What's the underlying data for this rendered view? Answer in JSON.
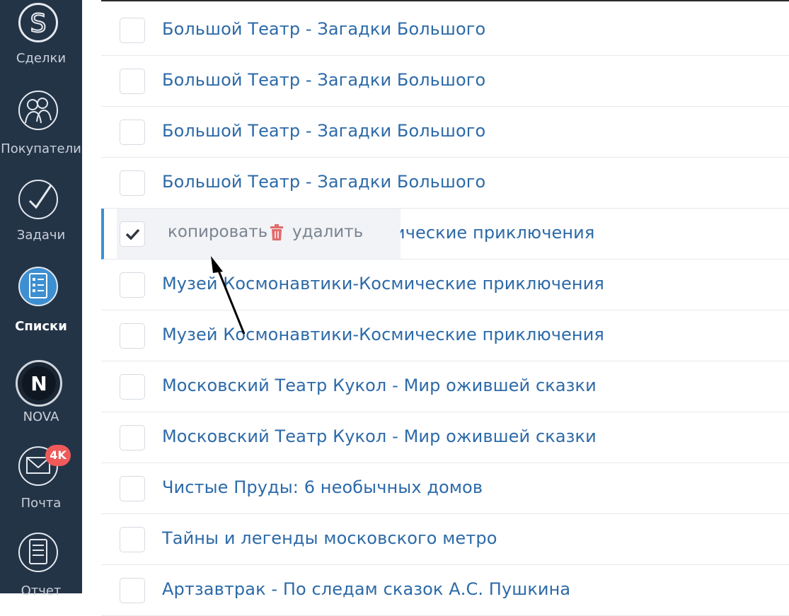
{
  "sidebar": {
    "items": [
      {
        "label": "Сделки",
        "icon": "deals-s-icon"
      },
      {
        "label": "Покупатели",
        "icon": "customers-icon"
      },
      {
        "label": "Задачи",
        "icon": "tasks-check-icon"
      },
      {
        "label": "Списки",
        "icon": "lists-icon",
        "active": true
      },
      {
        "label": "NOVA",
        "icon": "nova-icon"
      },
      {
        "label": "Почта",
        "icon": "mail-icon",
        "badge": "4K"
      },
      {
        "label": "Отчет",
        "icon": "report-icon"
      }
    ]
  },
  "actions": {
    "copy_label": "копировать",
    "delete_label": "удалить"
  },
  "rows": [
    {
      "title": "Большой Театр - Загадки Большого",
      "checked": false
    },
    {
      "title": "Большой Театр - Загадки Большого",
      "checked": false
    },
    {
      "title": "Большой Театр - Загадки Большого",
      "checked": false
    },
    {
      "title": "Большой Театр - Загадки Большого",
      "checked": false
    },
    {
      "title": "ические приключения",
      "checked": true
    },
    {
      "title": "Музей Космонавтики-Космические приключения",
      "checked": false
    },
    {
      "title": "Музей Космонавтики-Космические приключения",
      "checked": false
    },
    {
      "title": "Московский Театр Кукол - Мир ожившей сказки",
      "checked": false
    },
    {
      "title": "Московский Театр Кукол - Мир ожившей сказки",
      "checked": false
    },
    {
      "title": "Чистые Пруды: 6 необычных домов",
      "checked": false
    },
    {
      "title": "Тайны и легенды московского метро",
      "checked": false
    },
    {
      "title": "Артзавтрак - По следам сказок А.С. Пушкина",
      "checked": false
    }
  ],
  "colors": {
    "sidebar_bg": "#243447",
    "link": "#2d6aa8",
    "accent": "#3d8fd1",
    "badge": "#f05a5a",
    "delete_icon": "#e26b6b"
  }
}
